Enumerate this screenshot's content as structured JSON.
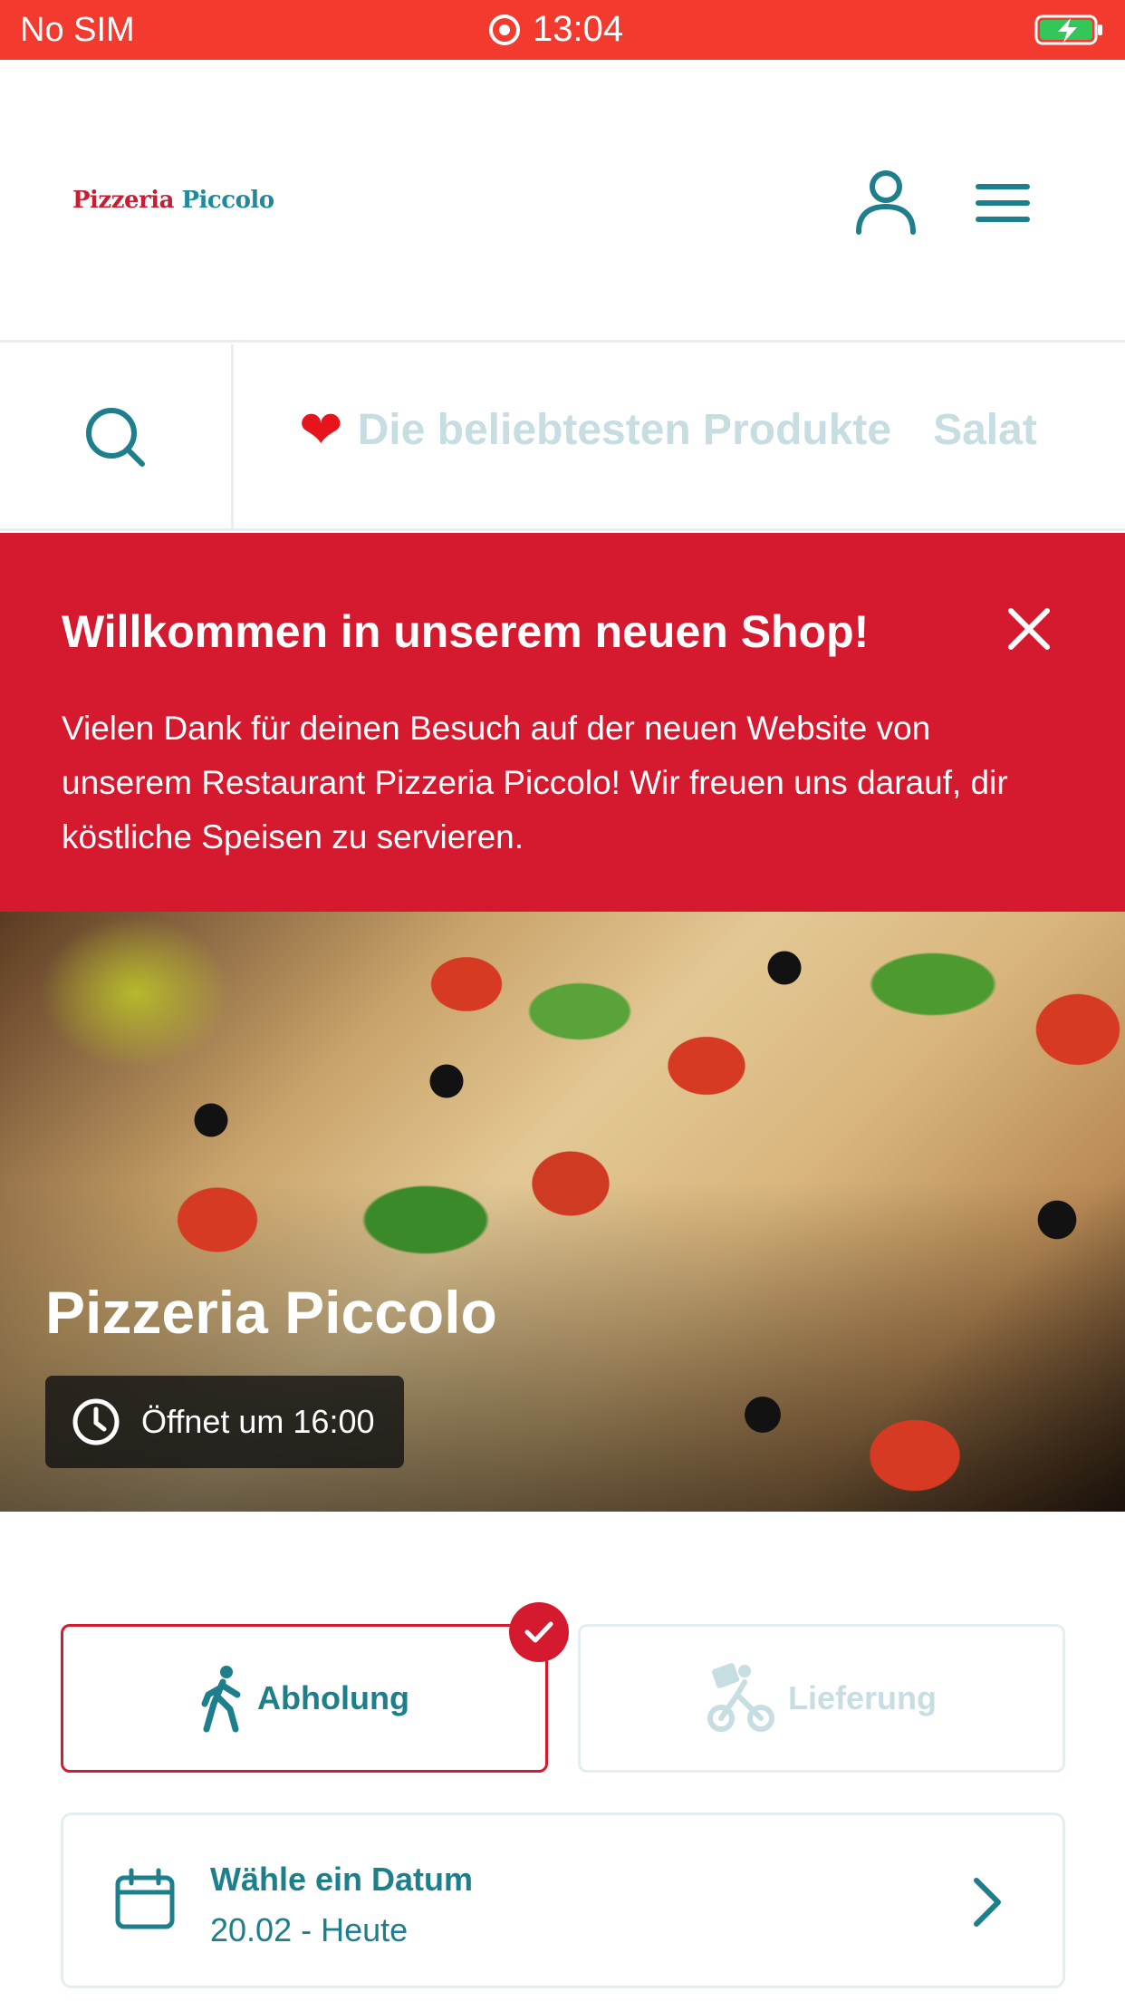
{
  "status_bar": {
    "carrier": "No SIM",
    "time": "13:04"
  },
  "header": {
    "logo_word1": "Pizzeria",
    "logo_word2": "Piccolo"
  },
  "categories": {
    "items": [
      "Die beliebtesten Produkte",
      "Salat"
    ]
  },
  "banner": {
    "title": "Willkommen in unserem neuen Shop!",
    "text": "Vielen Dank für deinen Besuch auf der neuen Website von unserem Restaurant Pizzeria Piccolo! Wir freuen uns darauf, dir köstliche Speisen zu servieren."
  },
  "hero": {
    "name": "Pizzeria Piccolo",
    "hours": "Öffnet um 16:00"
  },
  "order_type": {
    "pickup": "Abholung",
    "delivery": "Lieferung",
    "selected": "pickup"
  },
  "date_picker": {
    "title": "Wähle ein Datum",
    "value": "20.02 - Heute"
  },
  "colors": {
    "status_bar": "#f23a2f",
    "brand_red": "#d51a2f",
    "teal": "#1d7e8c",
    "muted": "#c6dde2"
  }
}
